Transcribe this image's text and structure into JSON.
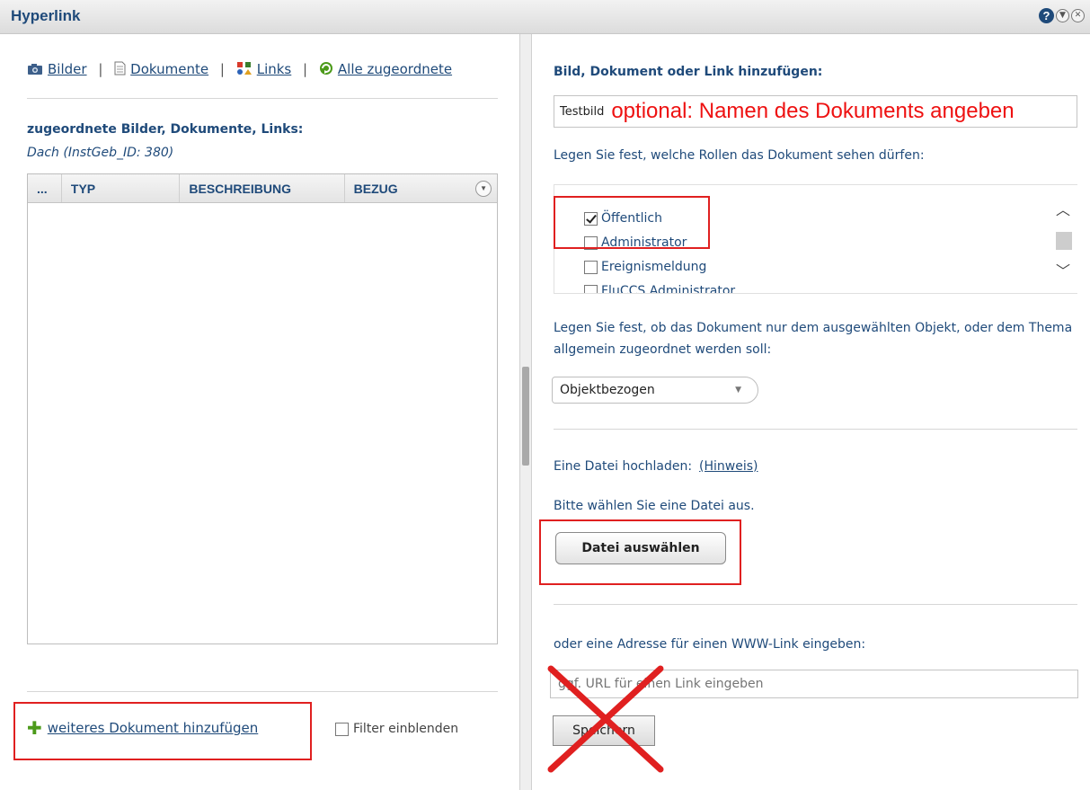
{
  "window": {
    "title": "Hyperlink",
    "help_label": "?"
  },
  "left": {
    "nav": {
      "bilder": "Bilder",
      "dokumente": "Dokumente",
      "links": "Links",
      "alle": "Alle zugeordnete",
      "separator": "|"
    },
    "section_title": "zugeordnete Bilder, Dokumente, Links:",
    "subtitle": "Dach (InstGeb_ID: 380)",
    "grid": {
      "columns": [
        "...",
        "TYP",
        "BESCHREIBUNG",
        "BEZUG"
      ],
      "rows": []
    },
    "add_document_label": "weiteres Dokument hinzufügen",
    "filter_label": "Filter einblenden",
    "filter_checked": false
  },
  "right": {
    "title": "Bild, Dokument oder Link hinzufügen:",
    "name_value": "Testbild",
    "name_note": "optional: Namen des Dokuments angeben",
    "roles_label": "Legen Sie fest, welche Rollen das Dokument sehen dürfen:",
    "roles": [
      {
        "label": "Öffentlich",
        "checked": true
      },
      {
        "label": "Administrator",
        "checked": false
      },
      {
        "label": "Ereignismeldung",
        "checked": false
      },
      {
        "label": "FluCCS Administrator",
        "checked": false
      }
    ],
    "assign_description": "Legen Sie fest, ob das Dokument nur dem ausgewählten Objekt, oder dem Thema allgemein zugeordnet werden soll:",
    "assign_select_value": "Objektbezogen",
    "upload_label": "Eine Datei hochladen:",
    "upload_hint": "(Hinweis)",
    "choose_file_prompt": "Bitte wählen Sie eine Datei aus.",
    "choose_file_button": "Datei auswählen",
    "url_label": "oder eine Adresse für einen WWW-Link eingeben:",
    "url_placeholder": "ggf. URL für einen Link eingeben",
    "save_button": "Speichern"
  },
  "colors": {
    "primary_text": "#1f4a7a",
    "annotation_red": "#e02020",
    "add_icon_green": "#4c9a1a"
  },
  "icons": {
    "nav_bilder": "camera-icon",
    "nav_dokumente": "document-icon",
    "nav_links": "links-icon",
    "nav_alle": "assigned-icon",
    "add": "plus-icon"
  }
}
